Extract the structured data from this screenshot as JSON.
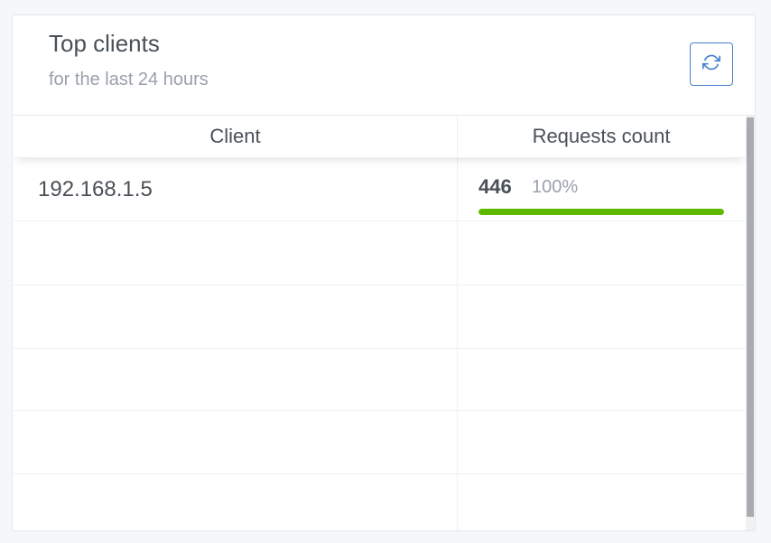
{
  "card": {
    "title": "Top clients",
    "subtitle": "for the last 24 hours",
    "refresh_icon": "refresh-icon"
  },
  "table": {
    "columns": [
      "Client",
      "Requests count"
    ],
    "rows": [
      {
        "client": "192.168.1.5",
        "count": "446",
        "percent": "100%",
        "fraction": 1.0
      },
      {
        "client": "",
        "count": "",
        "percent": "",
        "fraction": 0
      },
      {
        "client": "",
        "count": "",
        "percent": "",
        "fraction": 0
      },
      {
        "client": "",
        "count": "",
        "percent": "",
        "fraction": 0
      },
      {
        "client": "",
        "count": "",
        "percent": "",
        "fraction": 0
      },
      {
        "client": "",
        "count": "",
        "percent": "",
        "fraction": 0
      }
    ]
  },
  "colors": {
    "accent": "#467fcf",
    "progress": "#5eba00"
  }
}
